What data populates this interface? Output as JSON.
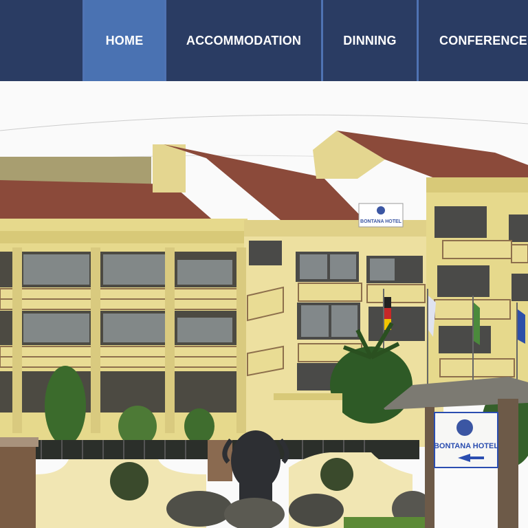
{
  "nav": {
    "items": [
      {
        "label": "HOME",
        "active": true
      },
      {
        "label": "ACCOMMODATION",
        "active": false
      },
      {
        "label": "DINNING",
        "active": false
      },
      {
        "label": "CONFERENCE",
        "active": false
      }
    ]
  },
  "photo": {
    "roof_sign": "BONTANA HOTEL",
    "gate_sign": "BONTANA HOTEL"
  },
  "colors": {
    "nav_bg": "#2a3c63",
    "nav_active": "#4a72b2",
    "nav_separator": "#4f73b3",
    "building_wall": "#e6d98c",
    "roof": "#8b4a3a"
  }
}
